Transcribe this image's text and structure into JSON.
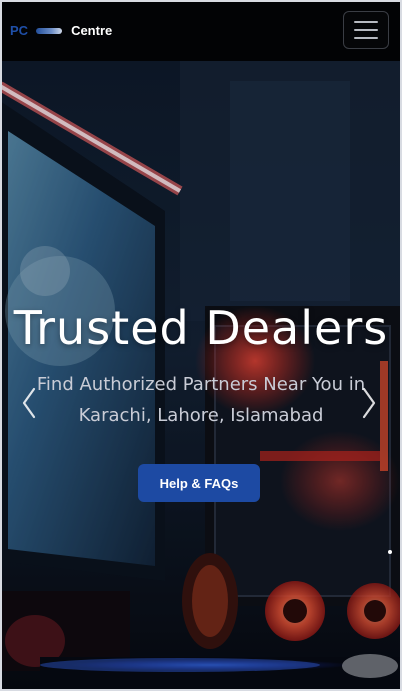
{
  "navbar": {
    "brand_prefix": "PC",
    "brand_name": "Centre",
    "menu_icon": "hamburger-menu-icon"
  },
  "hero": {
    "title": "Trusted Dealers",
    "subtitle_line1": "Find Authorized Partners Near You in",
    "subtitle_line2": "Karachi, Lahore, Islamabad",
    "cta_label": "Help & FAQs",
    "prev_icon": "chevron-left-icon",
    "next_icon": "chevron-right-icon"
  },
  "colors": {
    "brand_blue": "#1f4fa8",
    "cta_blue": "#1d4aa3",
    "navbar_bg": "#020305"
  }
}
